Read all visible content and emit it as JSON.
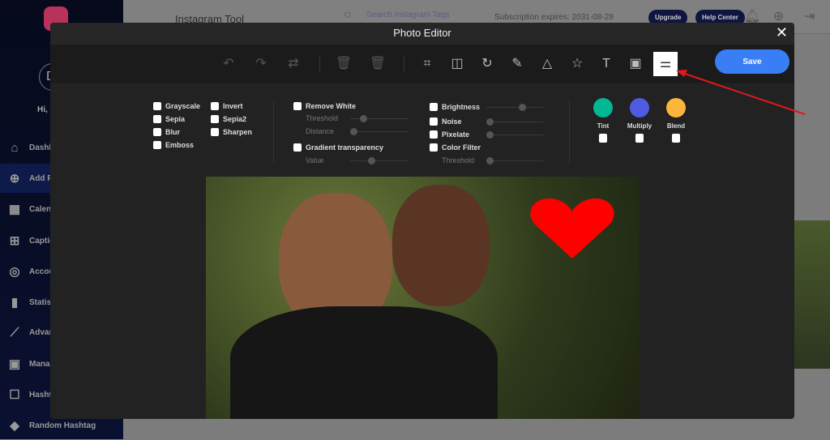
{
  "sidebar": {
    "avatar_letter": "D",
    "greeting": "Hi, I",
    "items": [
      {
        "label": "Dashb",
        "icon": "home-icon"
      },
      {
        "label": "Add F",
        "icon": "plus-circle-icon"
      },
      {
        "label": "Calen",
        "icon": "calendar-icon"
      },
      {
        "label": "Captio",
        "icon": "grid-icon"
      },
      {
        "label": "Accou",
        "icon": "instagram-icon"
      },
      {
        "label": "Statis",
        "icon": "bar-chart-icon"
      },
      {
        "label": "Advan",
        "icon": "line-chart-icon"
      },
      {
        "label": "Mana",
        "icon": "badge-icon"
      },
      {
        "label": "Hasht",
        "icon": "hashtag-list-icon"
      },
      {
        "label": "Random Hashtag",
        "icon": "tag-icon"
      }
    ]
  },
  "topbar": {
    "title": "Instagram Tool",
    "search_placeholder": "Search Instagram Tags",
    "subscription": "Subscription expires: 2031-08-29",
    "upgrade": "Upgrade",
    "help": "Help Center"
  },
  "modal": {
    "title": "Photo Editor",
    "save": "Save",
    "active_tool": "filters-icon",
    "filters_col1": [
      "Grayscale",
      "Sepia",
      "Blur",
      "Emboss"
    ],
    "filters_col2": [
      "Invert",
      "Sepia2",
      "Sharpen"
    ],
    "remove_white": {
      "label": "Remove White",
      "threshold": "Threshold",
      "distance": "Distance"
    },
    "gradient": {
      "label": "Gradient transparency",
      "value": "Value"
    },
    "adjust": {
      "brightness": "Brightness",
      "noise": "Noise",
      "pixelate": "Pixelate",
      "color_filter": "Color Filter",
      "threshold": "Threshold"
    },
    "blends": [
      {
        "label": "Tint",
        "color": "#00b894"
      },
      {
        "label": "Multiply",
        "color": "#4f5be0"
      },
      {
        "label": "Blend",
        "color": "#fdb53a"
      }
    ]
  },
  "colors": {
    "accent": "#3a7ef5",
    "annotation_arrow": "#e0191b",
    "heart": "#ff0000"
  }
}
